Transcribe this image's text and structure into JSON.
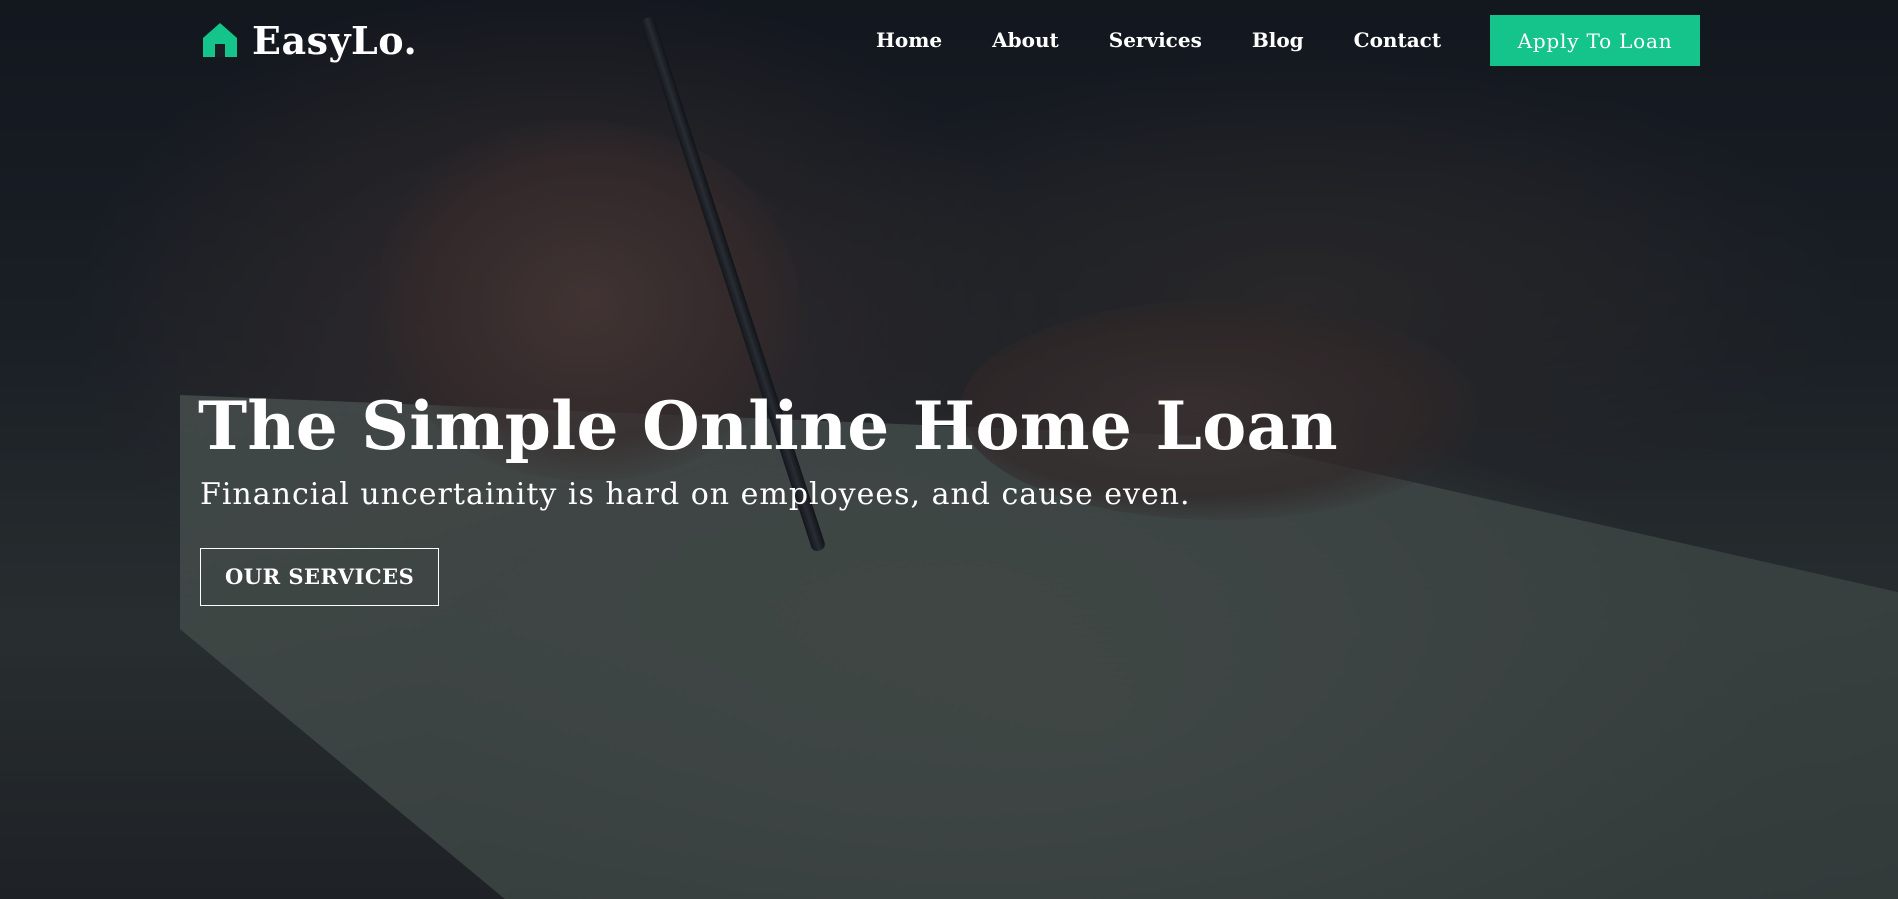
{
  "brand": {
    "name": "EasyLo.",
    "icon": "house-icon",
    "accent_color": "#15c48a"
  },
  "nav": {
    "links": [
      "Home",
      "About",
      "Services",
      "Blog",
      "Contact"
    ],
    "cta_label": "Apply To Loan"
  },
  "hero": {
    "title": "The Simple Online Home Loan",
    "subtitle": "Financial uncertainity is hard on employees, and cause even.",
    "button_label": "OUR SERVICES"
  }
}
